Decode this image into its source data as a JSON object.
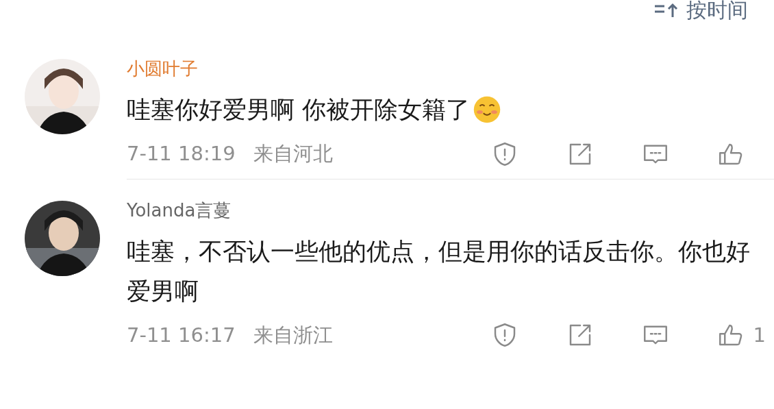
{
  "sort": {
    "label": "按时间"
  },
  "comments": [
    {
      "username": "小圆叶子",
      "vip": true,
      "text": "哇塞你好爱男啊 你被开除女籍了",
      "emoji": true,
      "time": "7-11 18:19",
      "location": "来自河北"
    },
    {
      "username": "Yolanda言蔓",
      "vip": false,
      "text": "哇塞，不否认一些他的优点，但是用你的话反击你。你也好爱男啊",
      "emoji": false,
      "time": "7-11 16:17",
      "location": "来自浙江",
      "likes": "1"
    }
  ]
}
